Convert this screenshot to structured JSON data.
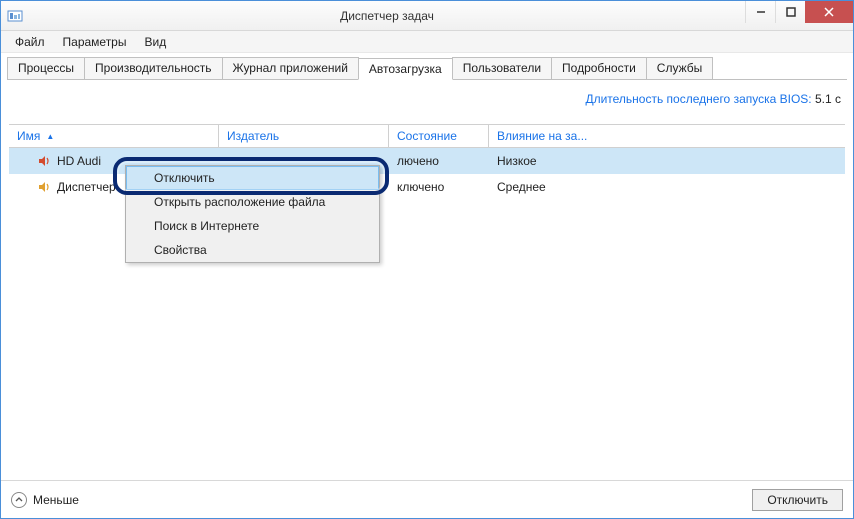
{
  "title": "Диспетчер задач",
  "menu": {
    "file": "Файл",
    "params": "Параметры",
    "view": "Вид"
  },
  "tabs": {
    "processes": "Процессы",
    "performance": "Производительность",
    "apphistory": "Журнал приложений",
    "startup": "Автозагрузка",
    "users": "Пользователи",
    "details": "Подробности",
    "services": "Службы"
  },
  "bios": {
    "label": "Длительность последнего запуска BIOS:",
    "value": "5.1 c"
  },
  "headers": {
    "name": "Имя",
    "publisher": "Издатель",
    "state": "Состояние",
    "impact": "Влияние на за..."
  },
  "rows": [
    {
      "name": "HD Audi",
      "publisher": "",
      "state": "лючено",
      "impact": "Низкое"
    },
    {
      "name": "Диспетчер",
      "publisher": "",
      "state": "ключено",
      "impact": "Среднее"
    }
  ],
  "context": {
    "disable": "Отключить",
    "openloc": "Открыть расположение файла",
    "searchweb": "Поиск в Интернете",
    "props": "Свойства"
  },
  "footer": {
    "less": "Меньше",
    "disable": "Отключить"
  }
}
